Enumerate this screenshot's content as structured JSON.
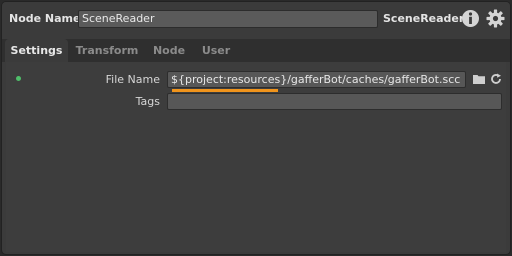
{
  "header": {
    "node_name_label": "Node Name",
    "node_name_value": "SceneReader",
    "node_type": "SceneReader",
    "info_icon": "info-icon",
    "gear_icon": "gear-icon"
  },
  "tabs": [
    {
      "label": "Settings",
      "active": true
    },
    {
      "label": "Transform",
      "active": false
    },
    {
      "label": "Node",
      "active": false
    },
    {
      "label": "User",
      "active": false
    }
  ],
  "settings": {
    "file_name_label": "File Name",
    "file_name_value": "${project:resources}/gafferBot/caches/gafferBot.scc",
    "tags_label": "Tags",
    "tags_value": ""
  },
  "colors": {
    "accent_underline": "#f0941c",
    "status_dot": "#4fbf6a",
    "panel_bg": "#3b3b3b",
    "field_bg": "#575757"
  }
}
